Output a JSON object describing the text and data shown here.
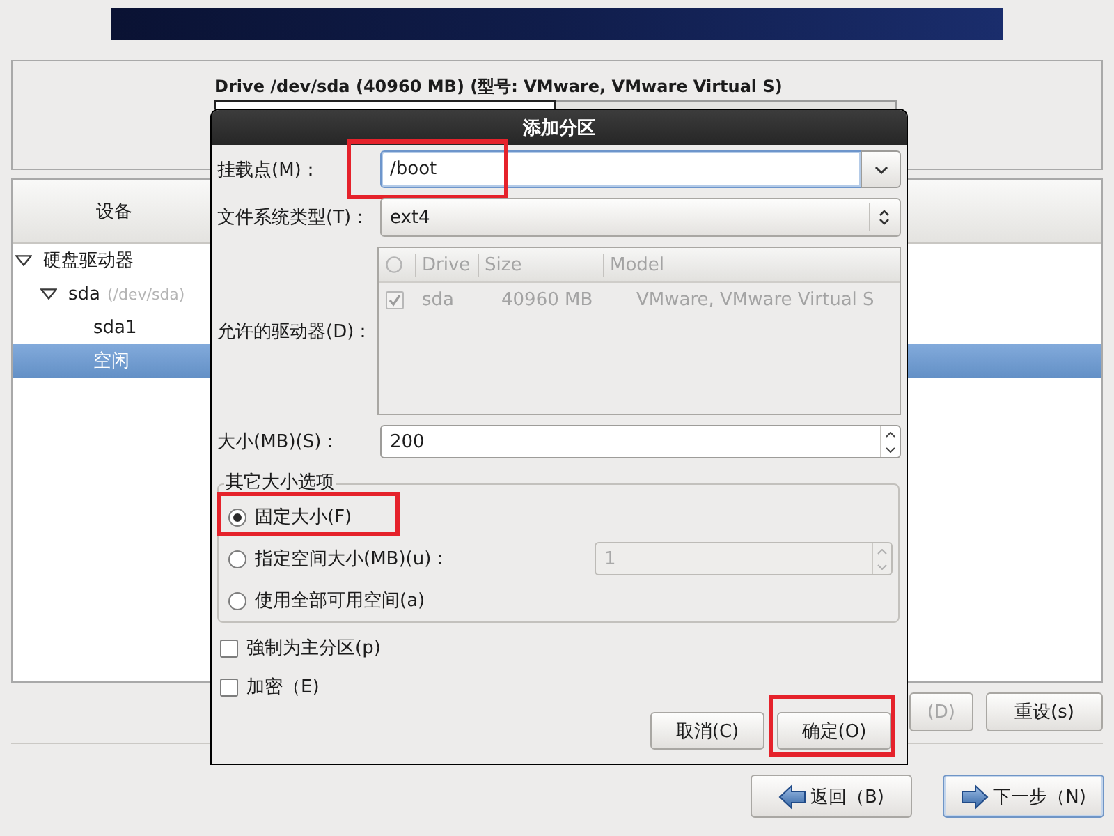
{
  "drive": {
    "title": "Drive /dev/sda (40960 MB) (型号: VMware, VMware Virtual S)"
  },
  "device_tree": {
    "column": "设备",
    "items": [
      {
        "label": "硬盘驱动器",
        "expanded": true,
        "selected": false,
        "children": [
          {
            "label": "sda",
            "detail": "(/dev/sda)",
            "expanded": true,
            "selected": false,
            "children": [
              {
                "label": "sda1",
                "selected": false
              },
              {
                "label": "空闲",
                "selected": true
              }
            ]
          }
        ]
      }
    ]
  },
  "partition_buttons": [
    {
      "label": "(D)",
      "disabled": true
    },
    {
      "label": "重设(s)",
      "disabled": false
    }
  ],
  "nav_buttons": [
    {
      "kind": "back",
      "label": "返回（B)",
      "focused": false
    },
    {
      "kind": "next",
      "label": "下一步（N)",
      "focused": true
    }
  ],
  "dialog": {
    "title": "添加分区",
    "fields": [
      {
        "kind": "combo",
        "label": "挂载点(M)：",
        "value": "/boot",
        "focused": true,
        "highlighted": true
      },
      {
        "kind": "select",
        "label": "文件系统类型(T)：",
        "value": "ext4",
        "highlighted": false
      },
      {
        "kind": "drive_list",
        "label": "允许的驱动器(D)：",
        "disabled": true,
        "highlighted": false,
        "columns": [
          "Drive",
          "Size",
          "Model"
        ],
        "rows": [
          {
            "checked": true,
            "cells": [
              "sda",
              "40960 MB",
              "VMware, VMware Virtual S"
            ]
          }
        ]
      },
      {
        "kind": "spin",
        "label": "大小(MB)(S)：",
        "value": "200",
        "highlighted": false
      }
    ],
    "size_options": {
      "title": "其它大小选项",
      "options": [
        {
          "label": "固定大小(F)",
          "selected": true,
          "highlighted": true
        },
        {
          "label": "指定空间大小(MB)(u)：",
          "selected": false,
          "highlighted": false,
          "spin": {
            "value": "1",
            "disabled": true
          }
        },
        {
          "label": "使用全部可用空间(a)",
          "selected": false,
          "highlighted": false
        }
      ]
    },
    "checkboxes": [
      {
        "label": "強制为主分区(p)",
        "checked": false
      },
      {
        "label": "加密（E)",
        "checked": false
      }
    ],
    "buttons": [
      {
        "label": "取消(C)",
        "highlighted": false
      },
      {
        "label": "确定(O)",
        "highlighted": true
      }
    ]
  }
}
